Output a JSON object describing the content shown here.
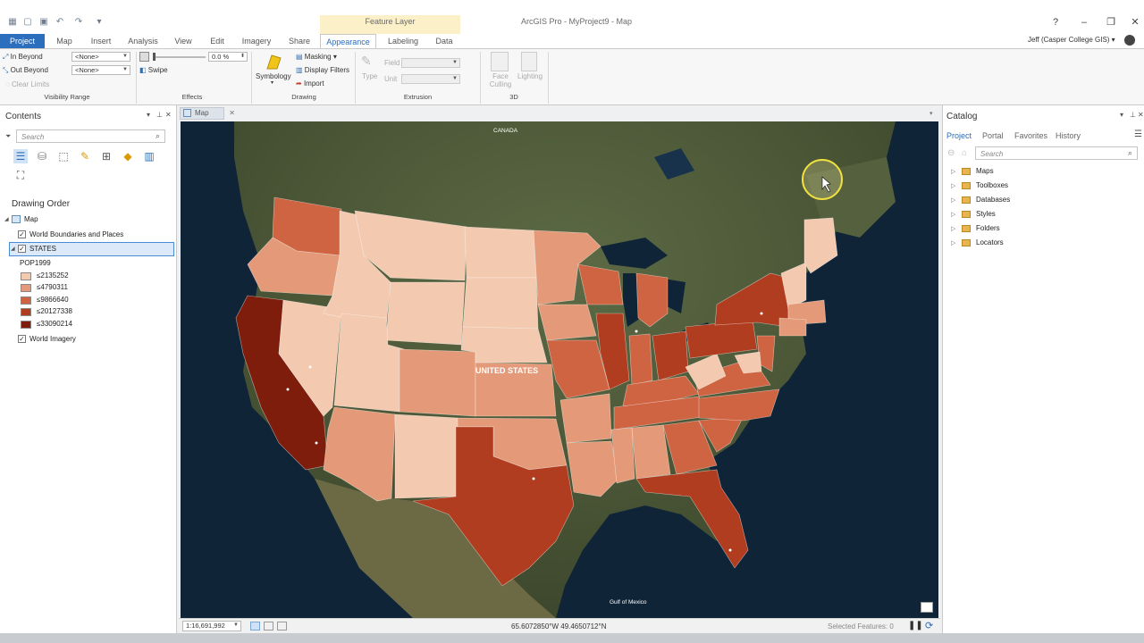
{
  "titlebar": {
    "context_tab_label": "Feature Layer",
    "app_title": "ArcGIS Pro - MyProject9 - Map",
    "help": "?",
    "minimize": "–",
    "restore": "❐",
    "close": "✕"
  },
  "ribbon_tabs": [
    "Project",
    "Map",
    "Insert",
    "Analysis",
    "View",
    "Edit",
    "Imagery",
    "Share",
    "Appearance",
    "Labeling",
    "Data"
  ],
  "user": "Jeff (Casper College GIS)",
  "ribbon": {
    "visibility": {
      "in_beyond": "In Beyond",
      "out_beyond": "Out Beyond",
      "clear_limits": "Clear Limits",
      "in_value": "<None>",
      "out_value": "<None>",
      "group_label": "Visibility Range"
    },
    "effects": {
      "transparency_value": "0.0 %",
      "swipe": "Swipe",
      "group_label": "Effects"
    },
    "drawing": {
      "symbology": "Symbology",
      "masking": "Masking",
      "display_filters": "Display Filters",
      "import": "Import",
      "group_label": "Drawing"
    },
    "extrusion": {
      "type": "Type",
      "field": "Field",
      "unit": "Unit",
      "group_label": "Extrusion"
    },
    "three_d": {
      "face_culling": "Face Culling",
      "lighting": "Lighting",
      "group_label": "3D"
    }
  },
  "contents": {
    "title": "Contents",
    "search_placeholder": "Search",
    "drawing_order": "Drawing Order",
    "map_node": "Map",
    "layers": {
      "world_boundaries": "World Boundaries and Places",
      "states": "STATES",
      "field": "POP1999",
      "legend": [
        {
          "label": "≤2135252",
          "color": "#f3c9b0"
        },
        {
          "label": "≤4790311",
          "color": "#e49a78"
        },
        {
          "label": "≤9866640",
          "color": "#cf6443"
        },
        {
          "label": "≤20127338",
          "color": "#b03d1f"
        },
        {
          "label": "≤33090214",
          "color": "#7f1d0c"
        }
      ],
      "world_imagery": "World Imagery"
    }
  },
  "map": {
    "tab_label": "Map",
    "country_label": "UNITED STATES",
    "canada_label": "CANADA",
    "gulf_label": "Gulf of Mexico"
  },
  "statusbar": {
    "scale": "1:16,691,992",
    "coordinates": "65.6072850°W 49.4650712°N",
    "selected": "Selected Features: 0"
  },
  "catalog": {
    "title": "Catalog",
    "tabs": [
      "Project",
      "Portal",
      "Favorites",
      "History"
    ],
    "search_placeholder": "Search",
    "items": [
      "Maps",
      "Toolboxes",
      "Databases",
      "Styles",
      "Folders",
      "Locators"
    ]
  },
  "colors": {
    "accent": "#2a6ebd",
    "ocean": "#0f2437",
    "land": "#4d5a3a"
  }
}
